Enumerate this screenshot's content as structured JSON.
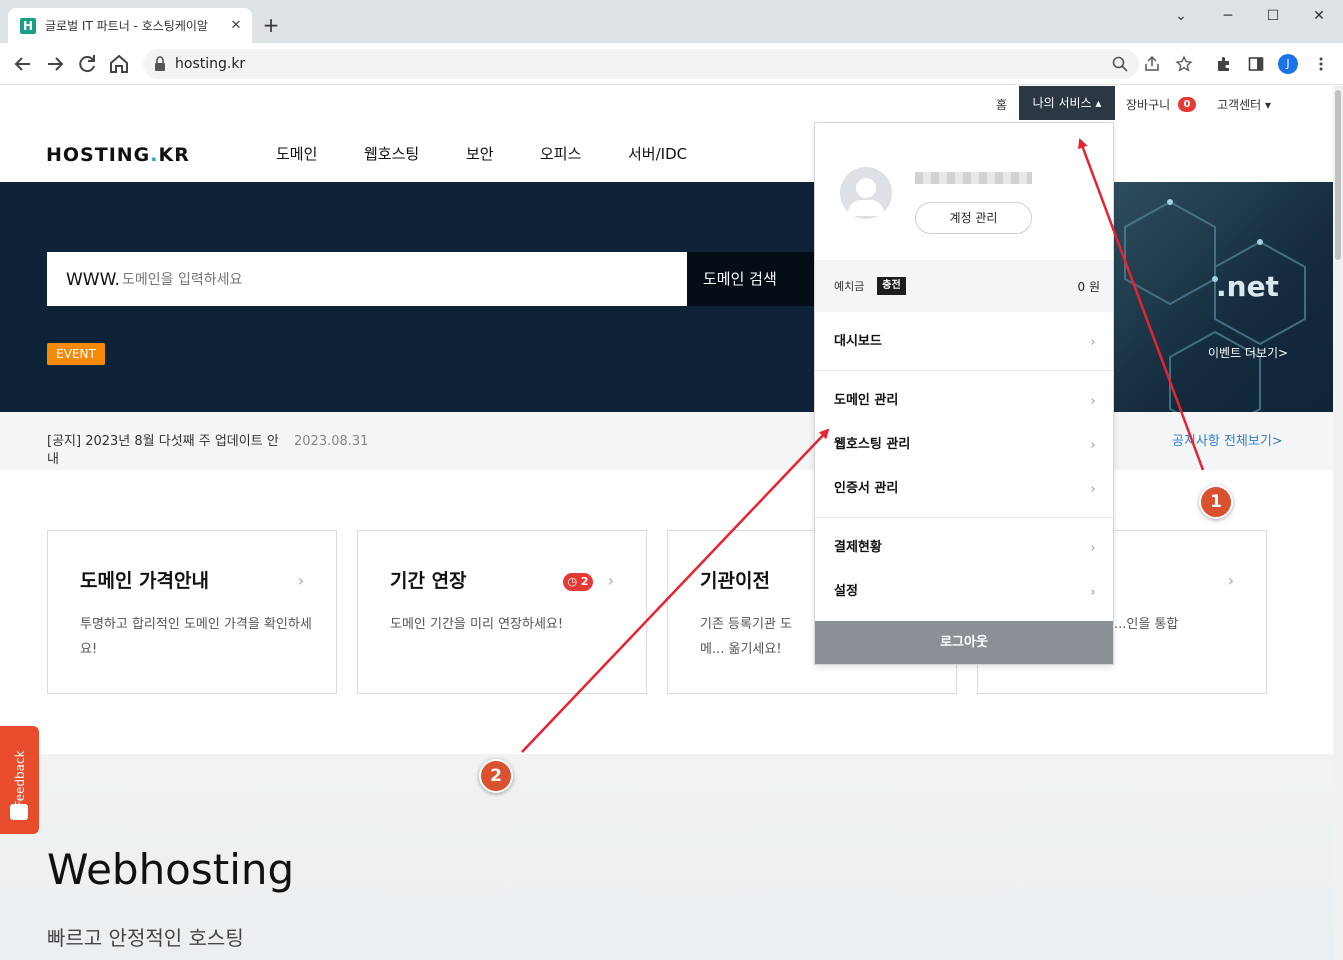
{
  "browser": {
    "tab_title": "글로벌 IT 파트너 - 호스팅케이알",
    "favicon_letter": "H",
    "tab_close": "✕",
    "new_tab": "+",
    "url": "hosting.kr",
    "profile_initial": "J",
    "window_controls": {
      "minimize": "─",
      "restore": "☐",
      "close": "✕",
      "tab_menu": "⌄"
    }
  },
  "header": {
    "util_nav": {
      "home": "홈",
      "my_service": "나의 서비스 ▴",
      "cart": "장바구니",
      "cart_count": "0",
      "support": "고객센터 ▾"
    },
    "logo_left": "HOSTING",
    "logo_dot": ".",
    "logo_right": "KR",
    "gnb": [
      "도메인",
      "웹호스팅",
      "보안",
      "오피스",
      "서버/IDC"
    ]
  },
  "hero": {
    "www": "WWW.",
    "placeholder": "도메인을 입력하세요",
    "search_button": "도메인 검색",
    "event_badge": "EVENT",
    "banner_net": ".net",
    "banner_more": "이벤트 더보기>"
  },
  "notice": {
    "text": "[공지] 2023년 8월 다섯째 주 업데이트 안내",
    "date": "2023.08.31",
    "more": "공지사항 전체보기>"
  },
  "cards": [
    {
      "title": "도메인 가격안내",
      "desc": "투명하고 합리적인 도메인 가격을 확인하세요!"
    },
    {
      "title": "기간 연장",
      "desc": "도메인 기간을 미리 연장하세요!",
      "badge": "2"
    },
    {
      "title": "기관이전",
      "desc": "기존 등록기관 도메... 옮기세요!"
    },
    {
      "title": "",
      "desc": "...인을 통합"
    }
  ],
  "card_chevron": "›",
  "badge_icon": "◷",
  "webhosting": {
    "title": "Webhosting",
    "subtitle": "빠르고 안정적인 호스팅"
  },
  "feedback": "Feedback",
  "dropdown": {
    "account_button": "계정 관리",
    "deposit_label": "예치금",
    "charge": "충전",
    "deposit_value": "0 원",
    "items": [
      {
        "label": "대시보드"
      },
      {
        "label": "도메인 관리"
      },
      {
        "label": "웹호스팅 관리"
      },
      {
        "label": "인증서 관리"
      },
      {
        "label": "결제현황"
      },
      {
        "label": "설정"
      }
    ],
    "chevron": "›",
    "logout": "로그아웃"
  },
  "annotations": {
    "marker1": "1",
    "marker2": "2"
  },
  "colors": {
    "hero_bg": "#0e2238",
    "accent_orange": "#f58a07",
    "annotation_red": "#e8232f",
    "marker": "#d9512f",
    "my_service_bg": "#2c3744"
  }
}
